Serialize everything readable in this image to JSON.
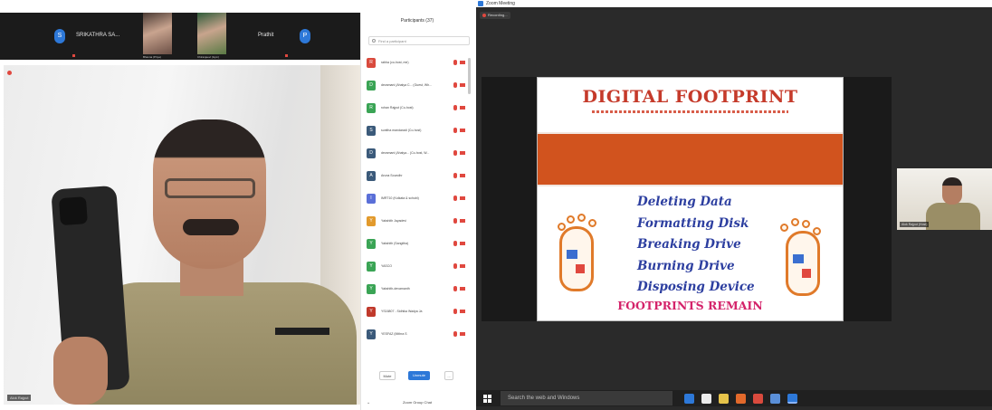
{
  "left_window": {
    "strip_tiles": [
      {
        "name": "SRIKATHRA SA...",
        "avatar": "S"
      },
      {
        "caption": "Bhavna (Priya)"
      },
      {
        "caption": "Chiranjeevi (Gym)"
      },
      {
        "name": "Prathit",
        "avatar": "P"
      }
    ],
    "main_video_name": "Alok Rajput",
    "participants": {
      "title": "Participants (37)",
      "search_placeholder": "Find a participant",
      "items": [
        {
          "name": "rabha (co-host, me)",
          "initial": "R",
          "color": "#d94a3d"
        },
        {
          "name": "devamani (Ahalya C... (Guest, Wh...",
          "initial": "D",
          "color": "#3aa455"
        },
        {
          "name": "rohan Rajput (Co-host)",
          "initial": "R",
          "color": "#3aa455"
        },
        {
          "name": "sunitha mandaradi (Co-host)",
          "initial": "S",
          "color": "#3b5a7a"
        },
        {
          "name": "devamani (Ahalya... (Co-host, W...",
          "initial": "D",
          "color": "#3b5a7a"
        },
        {
          "name": "Aruna Soundhr",
          "initial": "A",
          "color": "#3b5a7a"
        },
        {
          "name": "IMRT10 (Kolkata & schubi)",
          "initial": "I",
          "color": "#5a6fd8"
        },
        {
          "name": "Yakshith Jayadevi",
          "initial": "Y",
          "color": "#e29a2c"
        },
        {
          "name": "Yakshith (Sangitha)",
          "initial": "Y",
          "color": "#3aa455"
        },
        {
          "name": "YASCO",
          "initial": "Y",
          "color": "#3aa455"
        },
        {
          "name": "Yakshith-devamanth",
          "initial": "Y",
          "color": "#3aa455"
        },
        {
          "name": "YS16807 - Sidhika Wadya Ja",
          "initial": "Y",
          "color": "#c0392b"
        },
        {
          "name": "YESFAZ (Mithra S",
          "initial": "Y",
          "color": "#3b5a7a"
        }
      ],
      "mute_all": "Mute",
      "unmute_all": "Unmute",
      "more": "...",
      "chat_label": "Zoom Group Chat"
    }
  },
  "right_window": {
    "title": "Zoom Meeting",
    "recording": "Recording...",
    "slide": {
      "title": "DIGITAL FOOTPRINT",
      "items": [
        "Deleting Data",
        "Formatting Disk",
        "Breaking Drive",
        "Burning Drive",
        "Disposing Device"
      ],
      "footer": "FOOTPRINTS REMAIN"
    },
    "self_view_name": "Alok Rajput (Host)",
    "taskbar": {
      "search_placeholder": "Search the web and Windows",
      "apps": [
        {
          "icon": "edge-icon",
          "color": "#2d78d8"
        },
        {
          "icon": "store-icon",
          "color": "#eaeaea"
        },
        {
          "icon": "explorer-icon",
          "color": "#e6c34a"
        },
        {
          "icon": "firefox-icon",
          "color": "#e2692b"
        },
        {
          "icon": "chrome-icon",
          "color": "#d94a3d"
        },
        {
          "icon": "app-icon",
          "color": "#5a8fd8"
        },
        {
          "icon": "zoom-icon",
          "color": "#2d78d8"
        }
      ]
    }
  }
}
